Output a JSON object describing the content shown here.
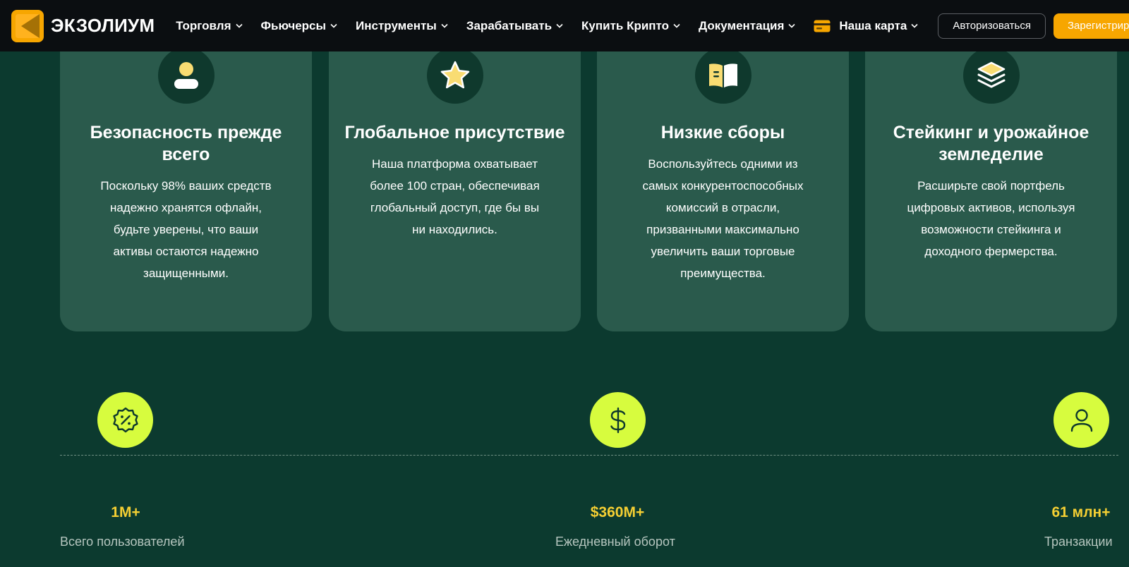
{
  "header": {
    "brand": "ЭКЗОЛИУМ",
    "nav": [
      {
        "label": "Торговля"
      },
      {
        "label": "Фьючерсы"
      },
      {
        "label": "Инструменты"
      },
      {
        "label": "Зарабатывать"
      },
      {
        "label": "Купить Крипто"
      },
      {
        "label": "Документация"
      },
      {
        "label": "Наша карта"
      }
    ],
    "login_label": "Авторизоваться",
    "register_label": "Зарегистрироваться",
    "colors": {
      "background": "#0b0e11",
      "accent": "#f7a600"
    }
  },
  "features": [
    {
      "icon": "user-icon",
      "title": "Безопасность прежде всего",
      "text": "Поскольку 98% ваших средств надежно хранятся офлайн, будьте уверены, что ваши активы остаются надежно защищенными."
    },
    {
      "icon": "star-icon",
      "title": "Глобальное присутствие",
      "text": "Наша платформа охватывает более 100 стран, обеспечивая глобальный доступ, где бы вы ни находились."
    },
    {
      "icon": "book-icon",
      "title": "Низкие сборы",
      "text": "Воспользуйтесь одними из самых конкурентоспособных комиссий в отрасли, призванными максимально увеличить ваши торговые преимущества."
    },
    {
      "icon": "layers-icon",
      "title": "Стейкинг и урожайное земледелие",
      "text": "Расширьте свой портфель цифровых активов, используя возможности стейкинга и доходного фермерства."
    }
  ],
  "stats": [
    {
      "icon": "percent-badge-icon",
      "value": "1M+",
      "label": "Всего пользователей"
    },
    {
      "icon": "dollar-icon",
      "value": "$360M+",
      "label": "Ежедневный оборот"
    },
    {
      "icon": "person-icon",
      "value": "61 млн+",
      "label": "Транзакции"
    }
  ],
  "colors": {
    "page_background": "#0c3a2f",
    "card_background": "#2a5a4c",
    "icon_circle": "#0f392d",
    "icon_yellow": "#f9dc72",
    "stat_circle": "#d7fc3e",
    "stat_value": "#f5cf33"
  }
}
